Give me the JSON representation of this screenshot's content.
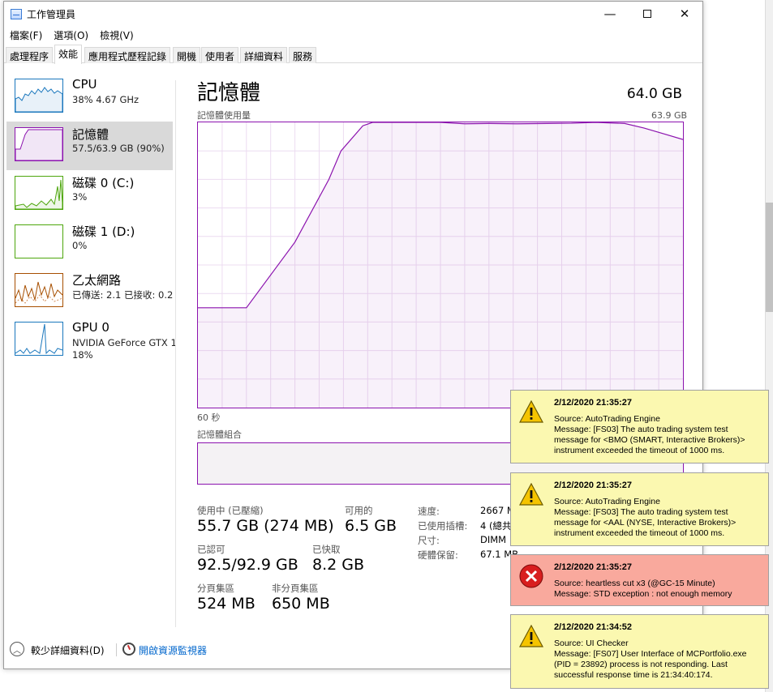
{
  "window": {
    "title": "工作管理員",
    "minimize_glyph": "—",
    "close_glyph": "✕"
  },
  "menu": [
    "檔案(F)",
    "選項(O)",
    "檢視(V)"
  ],
  "tabs": [
    "處理程序",
    "效能",
    "應用程式歷程記錄",
    "開機",
    "使用者",
    "詳細資料",
    "服務"
  ],
  "active_tab": "效能",
  "sidebar": {
    "items": [
      {
        "name": "CPU",
        "sub": "38% 4.67 GHz",
        "sub2": "",
        "color": "#1a77bd"
      },
      {
        "name": "記憶體",
        "sub": "57.5/63.9 GB (90%)",
        "sub2": "",
        "color": "#8b12ae"
      },
      {
        "name": "磁碟 0 (C:)",
        "sub": "3%",
        "sub2": "",
        "color": "#4da60c"
      },
      {
        "name": "磁碟 1 (D:)",
        "sub": "0%",
        "sub2": "",
        "color": "#4da60c"
      },
      {
        "name": "乙太網路",
        "sub": "已傳送: 2.1  已接收: 0.2",
        "sub2": "",
        "color": "#a74f01"
      },
      {
        "name": "GPU 0",
        "sub": "NVIDIA GeForce GTX 1",
        "sub2": "18%",
        "color": "#1a77bd"
      }
    ]
  },
  "main": {
    "title": "記憶體",
    "capacity": "64.0 GB",
    "usage_label": "記憶體使用量",
    "usage_max": "63.9 GB",
    "time_label": "60 秒",
    "composition_label": "記憶體組合",
    "accent": "#8b12ae"
  },
  "chart_data": {
    "type": "area",
    "x_range": [
      60,
      0
    ],
    "y_range": [
      0,
      63.9
    ],
    "points_pct": [
      [
        0,
        35
      ],
      [
        10,
        35
      ],
      [
        20,
        58
      ],
      [
        27,
        80
      ],
      [
        29.5,
        90
      ],
      [
        34,
        98.8
      ],
      [
        36,
        100
      ],
      [
        43,
        100
      ],
      [
        47,
        100
      ],
      [
        50,
        100
      ],
      [
        55,
        99.5
      ],
      [
        60,
        99.6
      ],
      [
        66,
        99.5
      ],
      [
        72,
        99.6
      ],
      [
        77,
        99.7
      ],
      [
        82,
        100
      ],
      [
        88,
        99.6
      ],
      [
        92,
        98
      ],
      [
        96,
        96
      ],
      [
        100,
        94
      ]
    ]
  },
  "stats": {
    "in_use_label": "使用中 (已壓縮)",
    "in_use_value": "55.7 GB (274 MB)",
    "available_label": "可用的",
    "available_value": "6.5 GB",
    "committed_label": "已認可",
    "committed_value": "92.5/92.9 GB",
    "cached_label": "已快取",
    "cached_value": "8.2 GB",
    "paged_label": "分頁集區",
    "paged_value": "524 MB",
    "nonpaged_label": "非分頁集區",
    "nonpaged_value": "650 MB",
    "speed_label": "速度:",
    "speed_value": "2667 M",
    "slots_label": "已使用插槽:",
    "slots_value": "4 (總共",
    "form_label": "尺寸:",
    "form_value": "DIMM",
    "reserved_label": "硬體保留:",
    "reserved_value": "67.1 MB"
  },
  "footer": {
    "fewer_details": "較少詳細資料(D)",
    "resource_monitor": "開啟資源監視器"
  },
  "notifications": [
    {
      "kind": "warning",
      "time": "2/12/2020 21:35:27",
      "lines": [
        "Source: AutoTrading Engine",
        "Message: [FS03] The auto trading system test",
        " message for <BMO (SMART, Interactive Brokers)>",
        " instrument exceeded the timeout of 1000 ms."
      ]
    },
    {
      "kind": "warning",
      "time": "2/12/2020 21:35:27",
      "lines": [
        "Source: AutoTrading Engine",
        "Message: [FS03] The auto trading system test",
        " message for <AAL (NYSE, Interactive Brokers)>",
        " instrument exceeded the timeout of 1000 ms."
      ]
    },
    {
      "kind": "error",
      "time": "2/12/2020 21:35:27",
      "lines": [
        "Source: heartless cut x3 (@GC-15 Minute)",
        "Message: STD exception : not enough memory"
      ]
    },
    {
      "kind": "warning",
      "time": "2/12/2020 21:34:52",
      "lines": [
        "Source: UI Checker",
        "Message: [FS07] User Interface of MCPortfolio.exe",
        " (PID = 23892) process is not responding. Last",
        " successful response time is 21:34:40:174."
      ]
    }
  ]
}
